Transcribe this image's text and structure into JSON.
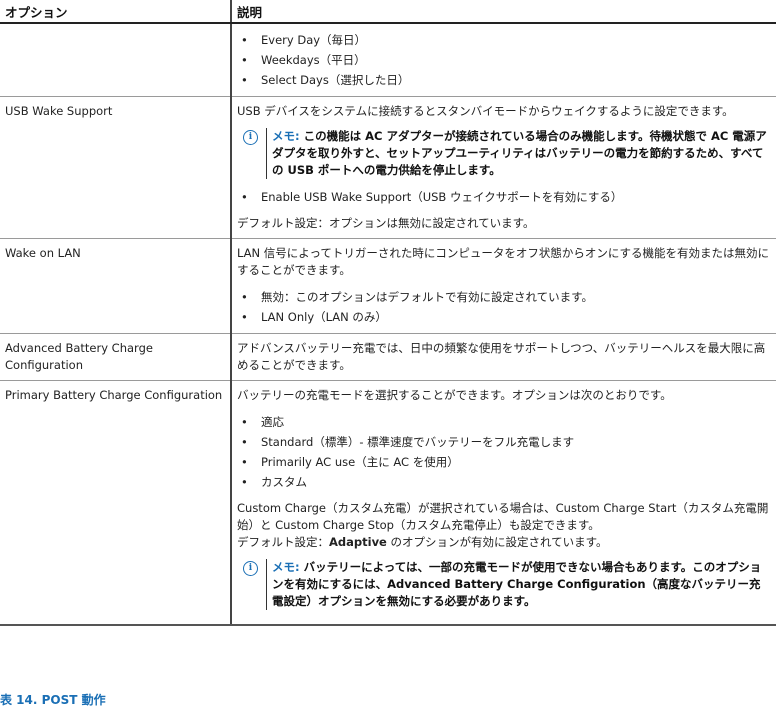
{
  "header": {
    "option": "オプション",
    "description": "説明"
  },
  "row0": {
    "option": "",
    "bullets": [
      "Every Day（毎日）",
      "Weekdays（平日）",
      "Select Days（選択した日）"
    ]
  },
  "row1": {
    "option": "USB Wake Support",
    "desc": "USB デバイスをシステムに接続するとスタンバイモードからウェイクするように設定できます。",
    "note_label": "メモ:",
    "note_text": " この機能は AC アダプターが接続されている場合のみ機能します。待機状態で AC 電源アダプタを取り外すと、セットアップユーティリティはバッテリーの電力を節約するため、すべての USB ポートへの電力供給を停止します。",
    "bullets": [
      "Enable USB Wake Support（USB ウェイクサポートを有効にする）"
    ],
    "default": "デフォルト設定：オプションは無効に設定されています。"
  },
  "row2": {
    "option": "Wake on LAN",
    "desc": "LAN 信号によってトリガーされた時にコンピュータをオフ状態からオンにする機能を有効または無効にすることができます。",
    "bullets": [
      "無効：このオプションはデフォルトで有効に設定されています。",
      "LAN Only（LAN のみ）"
    ]
  },
  "row3": {
    "option": "Advanced Battery Charge Configuration",
    "desc": "アドバンスバッテリー充電では、日中の頻繁な使用をサポートしつつ、バッテリーヘルスを最大限に高めることができます。"
  },
  "row4": {
    "option": "Primary Battery Charge Configuration",
    "desc": "バッテリーの充電モードを選択することができます。オプションは次のとおりです。",
    "bullets": [
      "適応",
      "Standard（標準）- 標準速度でバッテリーをフル充電します",
      "Primarily AC use（主に AC を使用）",
      "カスタム"
    ],
    "custom_text": "Custom Charge（カスタム充電）が選択されている場合は、Custom Charge Start（カスタム充電開始）と Custom Charge Stop（カスタム充電停止）も設定できます。",
    "default_prefix": "デフォルト設定：",
    "default_bold": "Adaptive",
    "default_suffix": " のオプションが有効に設定されています。",
    "note_label": "メモ:",
    "note_text": " バッテリーによっては、一部の充電モードが使用できない場合もあります。このオプションを有効にするには、Advanced Battery Charge Configuration（高度なバッテリー充電設定）オプションを無効にする必要があります。"
  },
  "caption": "表 14. POST 動作"
}
